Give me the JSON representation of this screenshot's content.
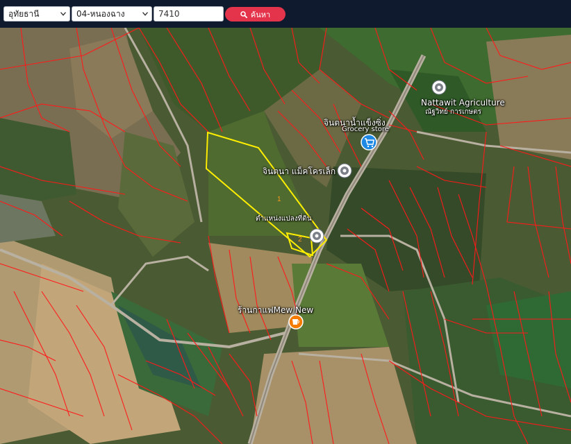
{
  "toolbar": {
    "province": "อุทัยธานี",
    "district": "04-หนองฉาง",
    "parcel_number": "7410",
    "search_label": "ค้นหา"
  },
  "map": {
    "poi": {
      "nattawit_name": "Nattawit Agriculture",
      "nattawit_sub": "ณัฐวิทย์ การเกษตร",
      "grocery_name": "จินตนาน้ำแข็งซิ่ง",
      "grocery_type": "Grocery store",
      "market_name": "จินตนา แม็คโครเล็ก",
      "parcel_label": "ตำแหน่งแปลงที่ดิน",
      "cafe_name": "ร้านกาแฟMew New"
    },
    "plots": [
      "1",
      "2"
    ],
    "colors": {
      "boundary": "#ff1a1a",
      "highlight": "#ffee00",
      "search_button": "#e4344b"
    }
  }
}
